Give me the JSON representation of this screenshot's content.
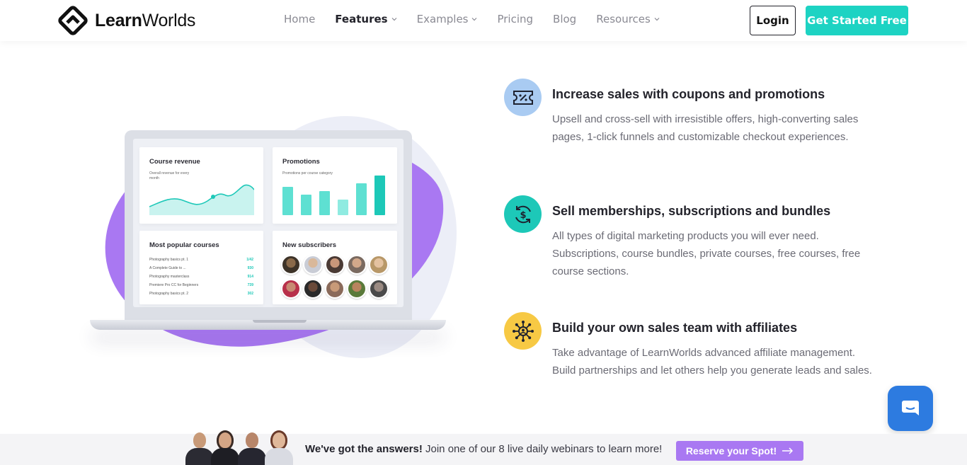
{
  "brand": {
    "name_bold": "Learn",
    "name_light": "Worlds"
  },
  "nav": {
    "items": [
      {
        "label": "Home",
        "dropdown": false,
        "active": false
      },
      {
        "label": "Features",
        "dropdown": true,
        "active": true
      },
      {
        "label": "Examples",
        "dropdown": true,
        "active": false
      },
      {
        "label": "Pricing",
        "dropdown": false,
        "active": false
      },
      {
        "label": "Blog",
        "dropdown": false,
        "active": false
      },
      {
        "label": "Resources",
        "dropdown": true,
        "active": false
      }
    ],
    "login_label": "Login",
    "cta_label": "Get Started Free"
  },
  "dashboard": {
    "revenue": {
      "title": "Course revenue",
      "subtitle": "Overall revenue for every month"
    },
    "promotions": {
      "title": "Promotions",
      "subtitle": "Promotions per course category"
    },
    "popular": {
      "title": "Most popular courses",
      "rows": [
        {
          "name": "Photography basics pt. 1",
          "value": "1/42"
        },
        {
          "name": "A Complete Guide to ...",
          "value": "930"
        },
        {
          "name": "Photography masterclass",
          "value": "914"
        },
        {
          "name": "Premiere Pro CC for Beginners",
          "value": "739"
        },
        {
          "name": "Photography basics pt. 2",
          "value": "302"
        }
      ]
    },
    "subscribers": {
      "title": "New subscribers"
    }
  },
  "features": [
    {
      "icon": "coupon-icon",
      "title": "Increase sales with coupons and promotions",
      "description": "Upsell and cross-sell with irresistible offers, high-converting sales pages, 1-click funnels and customizable checkout experiences."
    },
    {
      "icon": "dollar-cycle-icon",
      "title": "Sell memberships, subscriptions and bundles",
      "description": "All types of digital marketing products you will ever need. Subscriptions, course bundles, private courses, free courses, free course sections."
    },
    {
      "icon": "affiliate-network-icon",
      "title": "Build your own sales team with affiliates",
      "description": "Take advantage of LearnWorlds advanced affiliate management. Build partnerships and let others help you generate leads and sales."
    }
  ],
  "banner": {
    "bold_text": "We've got the answers!",
    "text": " Join one of our 8 live daily webinars to learn more!",
    "button_label": "Reserve your Spot!"
  },
  "colors": {
    "accent_teal": "#1dd3c3",
    "purple": "#a978f2",
    "chat_blue": "#2d7be0",
    "icon_bg_blue": "#a9cbf2",
    "icon_bg_teal": "#1dc8b8",
    "icon_bg_yellow": "#f7c944"
  }
}
